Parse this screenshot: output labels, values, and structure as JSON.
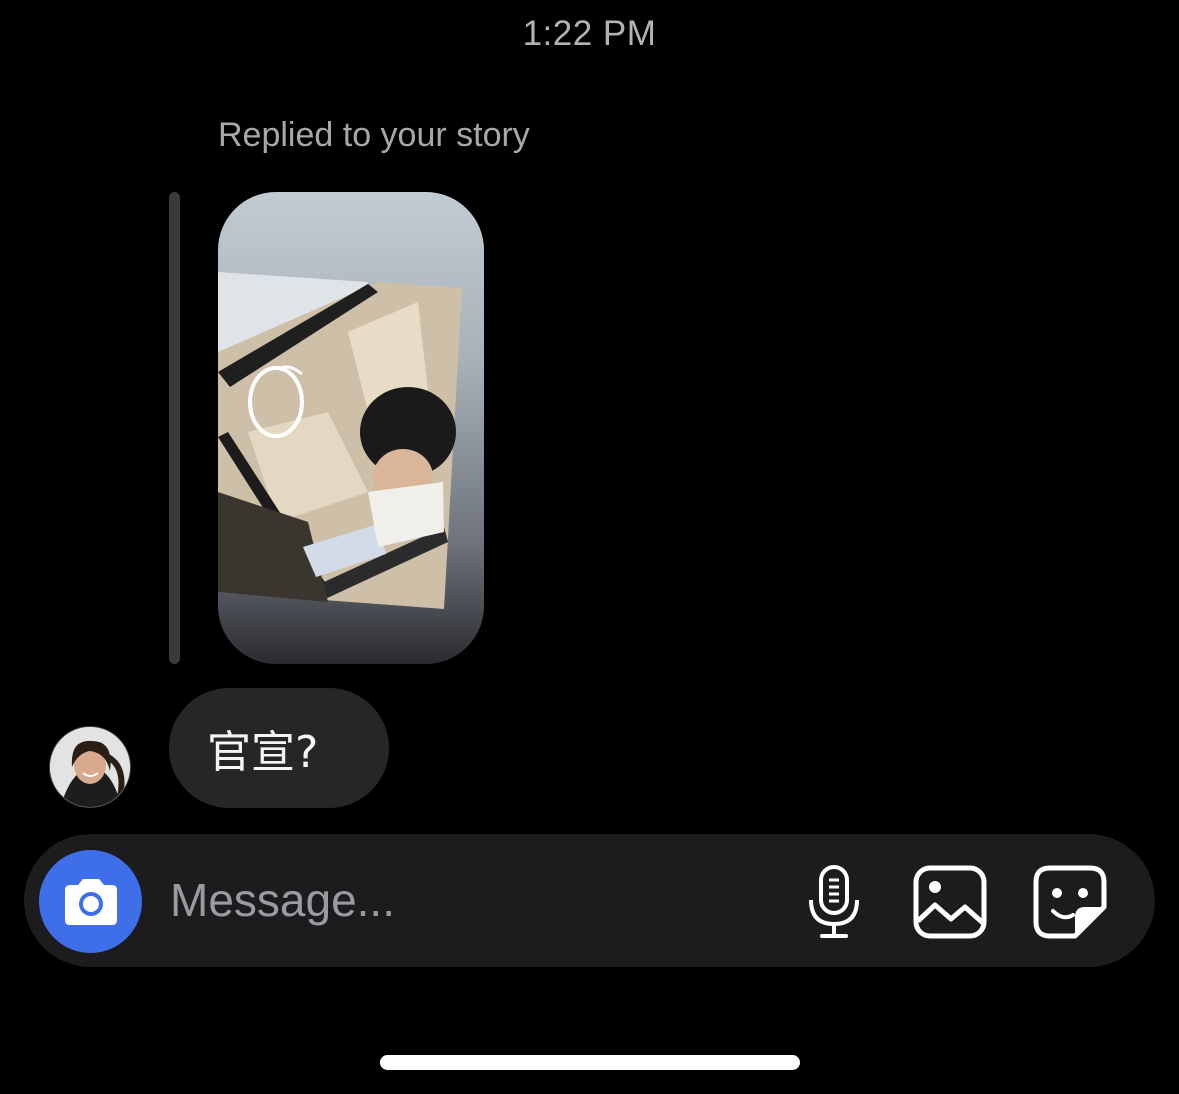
{
  "thread": {
    "timestamp": "1:22 PM",
    "reply_label": "Replied to your story",
    "message_text": "官宣?"
  },
  "composer": {
    "placeholder": "Message...",
    "camera_icon": "camera-icon",
    "mic_icon": "microphone-icon",
    "gallery_icon": "gallery-icon",
    "sticker_icon": "sticker-icon"
  },
  "colors": {
    "background": "#000000",
    "bubble": "#262626",
    "composer": "#1c1c1e",
    "camera_button": "#3f6fe8",
    "secondary_text": "#a8a8a8"
  }
}
